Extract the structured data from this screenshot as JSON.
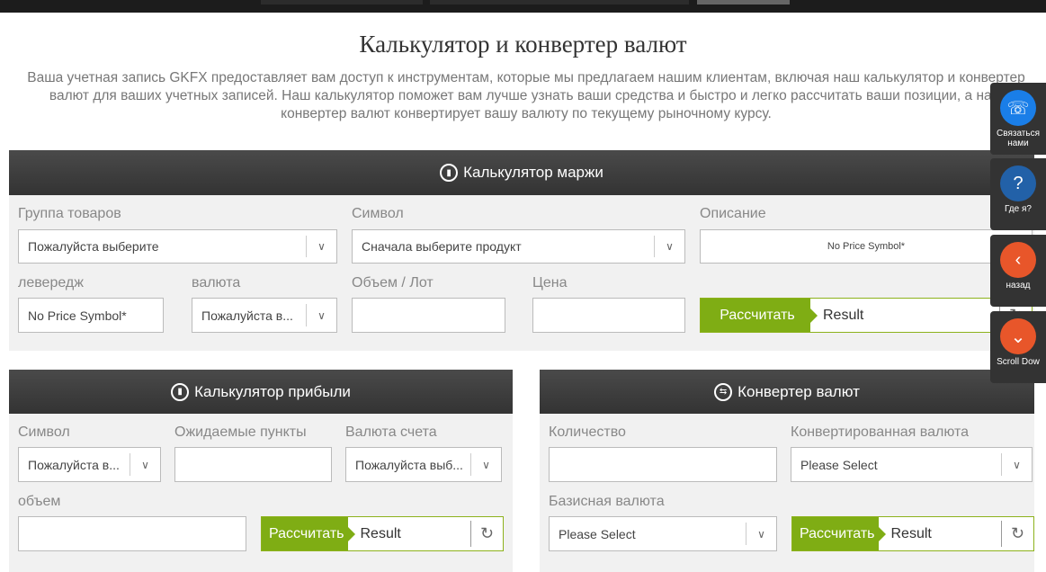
{
  "page": {
    "title": "Калькулятор и конвертер валют",
    "intro": "Ваша учетная запись GKFX предоставляет вам доступ к инструментам, которые мы предлагаем нашим клиентам, включая наш калькулятор и конвертер валют для ваших учетных записей. Наш калькулятор поможет вам лучше узнать ваши средства и быстро и легко рассчитать ваши позиции, а наш конвертер валют конвертирует вашу валюту по текущему рыночному курсу."
  },
  "margin": {
    "title": "Калькулятор маржи",
    "group_label": "Группа товаров",
    "group_value": "Пожалуйста выберите",
    "symbol_label": "Символ",
    "symbol_value": "Сначала выберите продукт",
    "desc_label": "Описание",
    "desc_value": "No Price Symbol*",
    "leverage_label": "левередж",
    "leverage_value": "No Price Symbol*",
    "currency_label": "валюта",
    "currency_value": "Пожалуйста в...",
    "volume_label": "Объем / Лот",
    "price_label": "Цена",
    "calc": "Рассчитать",
    "result": "Result"
  },
  "profit": {
    "title": "Калькулятор прибыли",
    "symbol_label": "Символ",
    "symbol_value": "Пожалуйста в...",
    "points_label": "Ожидаемые пункты",
    "acc_label": "Валюта счета",
    "acc_value": "Пожалуйста выб...",
    "volume_label": "объем",
    "calc": "Рассчитать",
    "result": "Result"
  },
  "converter": {
    "title": "Конвертер валют",
    "qty_label": "Количество",
    "conv_label": "Конвертированная валюта",
    "conv_value": "Please Select",
    "base_label": "Базисная валюта",
    "base_value": "Please Select",
    "calc": "Рассчитать",
    "result": "Result"
  },
  "widgets": [
    {
      "label": "Связаться нами",
      "icon": "phone-chat",
      "color": "#1a7ee8"
    },
    {
      "label": "Где я?",
      "icon": "location",
      "color": "#2261a8"
    },
    {
      "label": "назад",
      "icon": "chevron-left",
      "color": "#e8562a"
    },
    {
      "label": "Scroll Dow",
      "icon": "chevron-down",
      "color": "#e8562a"
    }
  ]
}
